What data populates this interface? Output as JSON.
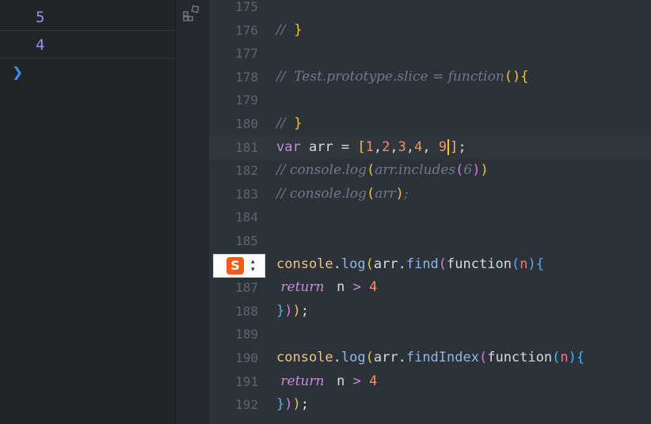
{
  "console": {
    "outputs": [
      "5",
      "4"
    ],
    "prompt_icon": "chevron-right-icon"
  },
  "ime": {
    "logo_text": "S",
    "icon": "sogou-ime-icon"
  },
  "editor": {
    "lines": [
      {
        "n": "175",
        "tokens": []
      },
      {
        "n": "176",
        "tokens": [
          {
            "t": "//  ",
            "c": "cm"
          },
          {
            "t": "}",
            "c": "p1"
          }
        ]
      },
      {
        "n": "177",
        "tokens": []
      },
      {
        "n": "178",
        "tokens": [
          {
            "t": "//  Test.prototype.slice = function",
            "c": "cm"
          },
          {
            "t": "(",
            "c": "p1"
          },
          {
            "t": ")",
            "c": "p1"
          },
          {
            "t": "{",
            "c": "p1"
          }
        ]
      },
      {
        "n": "179",
        "tokens": []
      },
      {
        "n": "180",
        "tokens": [
          {
            "t": "//  ",
            "c": "cm"
          },
          {
            "t": "}",
            "c": "p1"
          }
        ]
      },
      {
        "n": "181",
        "current": true,
        "tokens": [
          {
            "t": "var ",
            "c": "kw"
          },
          {
            "t": "arr = ",
            "c": "txt"
          },
          {
            "t": "[",
            "c": "p1"
          },
          {
            "t": "1",
            "c": "num"
          },
          {
            "t": ",",
            "c": "txt"
          },
          {
            "t": "2",
            "c": "num"
          },
          {
            "t": ",",
            "c": "txt"
          },
          {
            "t": "3",
            "c": "num"
          },
          {
            "t": ",",
            "c": "txt"
          },
          {
            "t": "4",
            "c": "num"
          },
          {
            "t": ", ",
            "c": "txt"
          },
          {
            "t": "9",
            "c": "num"
          },
          {
            "t": "",
            "c": "cursor"
          },
          {
            "t": "]",
            "c": "p1"
          },
          {
            "t": ";",
            "c": "txt"
          }
        ]
      },
      {
        "n": "182",
        "tokens": [
          {
            "t": "// console.log",
            "c": "cm"
          },
          {
            "t": "(",
            "c": "p1"
          },
          {
            "t": "arr.includes",
            "c": "cm"
          },
          {
            "t": "(",
            "c": "p2"
          },
          {
            "t": "6",
            "c": "cm"
          },
          {
            "t": ")",
            "c": "p2"
          },
          {
            "t": ")",
            "c": "p1"
          }
        ]
      },
      {
        "n": "183",
        "tokens": [
          {
            "t": "// console.log",
            "c": "cm"
          },
          {
            "t": "(",
            "c": "p1"
          },
          {
            "t": "arr",
            "c": "cm"
          },
          {
            "t": ")",
            "c": "p1"
          },
          {
            "t": ";",
            "c": "cm"
          }
        ]
      },
      {
        "n": "184",
        "tokens": []
      },
      {
        "n": "185",
        "tokens": []
      },
      {
        "n": "186",
        "tokens": [
          {
            "t": "console",
            "c": "fn"
          },
          {
            "t": ".",
            "c": "txt"
          },
          {
            "t": "log",
            "c": "mt"
          },
          {
            "t": "(",
            "c": "p1"
          },
          {
            "t": "arr",
            "c": "txt"
          },
          {
            "t": ".",
            "c": "txt"
          },
          {
            "t": "find",
            "c": "mt"
          },
          {
            "t": "(",
            "c": "p2"
          },
          {
            "t": "function",
            "c": "txt"
          },
          {
            "t": "(",
            "c": "p3"
          },
          {
            "t": "n",
            "c": "pn"
          },
          {
            "t": ")",
            "c": "p3"
          },
          {
            "t": "{",
            "c": "p3"
          }
        ]
      },
      {
        "n": "187",
        "tokens": [
          {
            "t": " return ",
            "c": "kwi"
          },
          {
            "t": " n ",
            "c": "txt"
          },
          {
            "t": "> ",
            "c": "kw"
          },
          {
            "t": "4",
            "c": "num"
          }
        ]
      },
      {
        "n": "188",
        "tokens": [
          {
            "t": "}",
            "c": "p3"
          },
          {
            "t": ")",
            "c": "p2"
          },
          {
            "t": ")",
            "c": "p1"
          },
          {
            "t": ";",
            "c": "txt"
          }
        ]
      },
      {
        "n": "189",
        "tokens": []
      },
      {
        "n": "190",
        "tokens": [
          {
            "t": "console",
            "c": "fn"
          },
          {
            "t": ".",
            "c": "txt"
          },
          {
            "t": "log",
            "c": "mt"
          },
          {
            "t": "(",
            "c": "p1"
          },
          {
            "t": "arr",
            "c": "txt"
          },
          {
            "t": ".",
            "c": "txt"
          },
          {
            "t": "findIndex",
            "c": "mt"
          },
          {
            "t": "(",
            "c": "p2"
          },
          {
            "t": "function",
            "c": "txt"
          },
          {
            "t": "(",
            "c": "p3"
          },
          {
            "t": "n",
            "c": "pn"
          },
          {
            "t": ")",
            "c": "p3"
          },
          {
            "t": "{",
            "c": "p3"
          }
        ]
      },
      {
        "n": "191",
        "tokens": [
          {
            "t": " return ",
            "c": "kwi"
          },
          {
            "t": " n ",
            "c": "txt"
          },
          {
            "t": "> ",
            "c": "kw"
          },
          {
            "t": "4",
            "c": "num"
          }
        ]
      },
      {
        "n": "192",
        "tokens": [
          {
            "t": "}",
            "c": "p3"
          },
          {
            "t": ")",
            "c": "p2"
          },
          {
            "t": ")",
            "c": "p1"
          },
          {
            "t": ";",
            "c": "txt"
          }
        ]
      }
    ]
  }
}
